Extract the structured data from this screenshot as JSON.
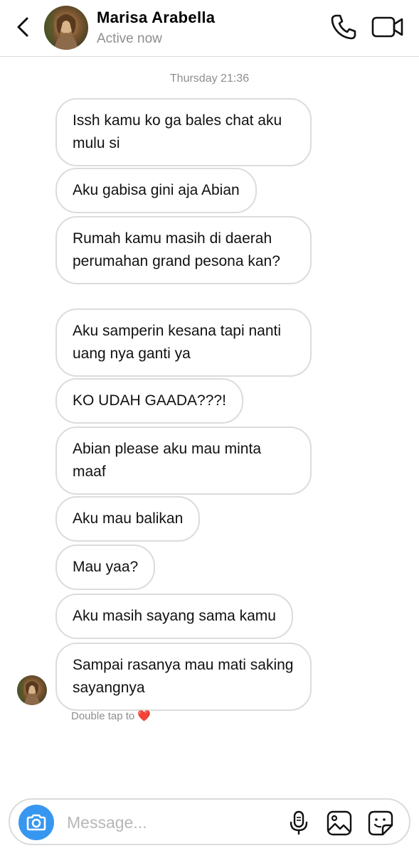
{
  "header": {
    "contact_name": "Marisa Arabella",
    "status": "Active now",
    "icons": {
      "back": "chevron-left-icon",
      "call": "phone-icon",
      "video": "video-camera-icon"
    }
  },
  "thread": {
    "timestamp": "Thursday 21:36",
    "messages": [
      "Issh kamu ko ga bales chat aku mulu si",
      "Aku gabisa gini aja Abian",
      "Rumah kamu masih di daerah perumahan grand pesona kan?",
      "Aku samperin kesana tapi nanti uang nya ganti ya",
      "KO UDAH GAADA???!",
      "Abian please aku mau minta maaf",
      "Aku mau balikan",
      "Mau yaa?",
      "Aku masih sayang sama kamu",
      "Sampai rasanya mau mati saking sayangnya"
    ],
    "hint_text": "Double tap to",
    "hint_emoji": "❤️"
  },
  "composer": {
    "placeholder": "Message...",
    "icons": {
      "camera": "camera-icon",
      "mic": "microphone-icon",
      "gallery": "image-icon",
      "sticker": "sticker-icon"
    }
  },
  "colors": {
    "accent": "#3797f0",
    "bubble_border": "#dcdcdc",
    "secondary_text": "#8e8e8e",
    "divider": "#dbdbdb"
  }
}
